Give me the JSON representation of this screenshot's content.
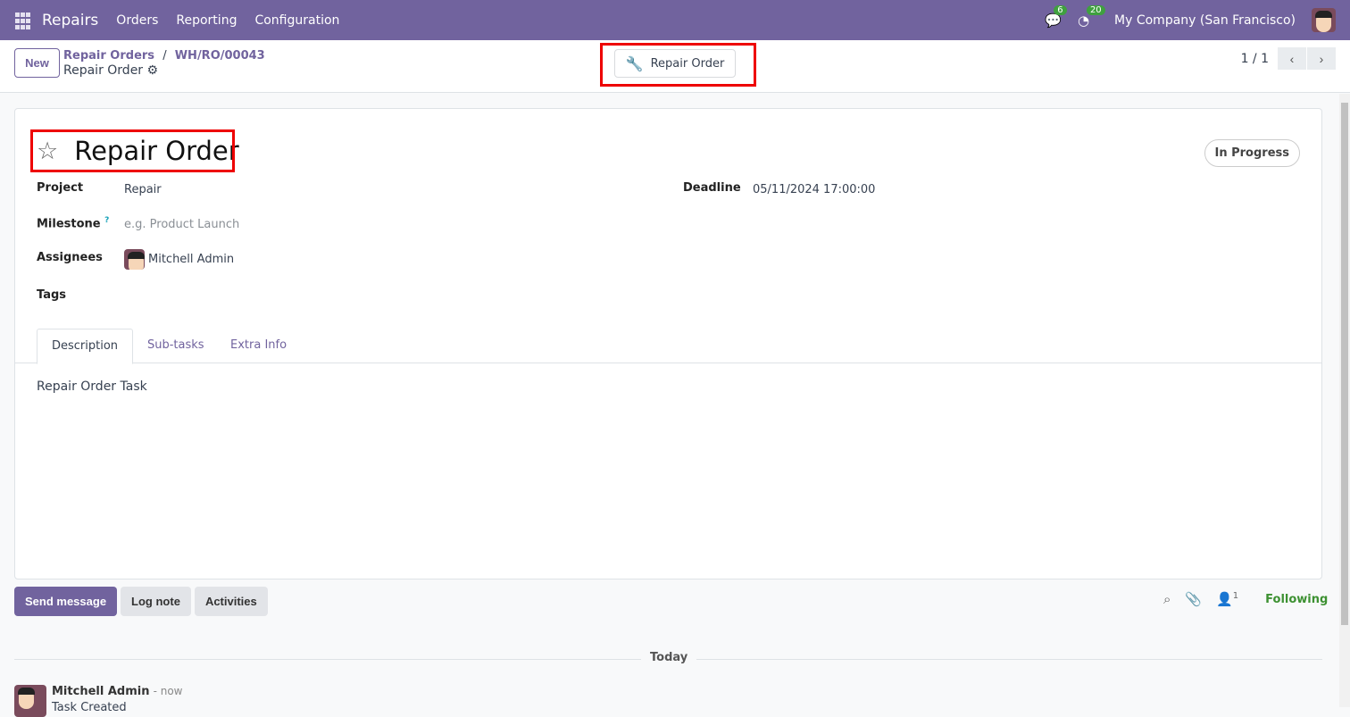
{
  "nav": {
    "app": "Repairs",
    "menu": [
      "Orders",
      "Reporting",
      "Configuration"
    ],
    "messages_count": "6",
    "activities_count": "20",
    "company": "My Company (San Francisco)"
  },
  "control": {
    "new_label": "New",
    "breadcrumb_parent": "Repair Orders",
    "breadcrumb_sep": "/",
    "breadcrumb_record": "WH/RO/00043",
    "current": "Repair Order",
    "smart_button": "Repair Order",
    "pager": "1 / 1"
  },
  "form": {
    "title": "Repair Order",
    "status": "In Progress",
    "project_label": "Project",
    "project": "Repair",
    "milestone_label": "Milestone",
    "milestone_help": "?",
    "milestone_placeholder": "e.g. Product Launch",
    "assignees_label": "Assignees",
    "assignee": "Mitchell Admin",
    "tags_label": "Tags",
    "deadline_label": "Deadline",
    "deadline": "05/11/2024 17:00:00",
    "tabs": [
      "Description",
      "Sub-tasks",
      "Extra Info"
    ],
    "description": "Repair Order Task"
  },
  "chatter": {
    "send": "Send message",
    "log": "Log note",
    "activities": "Activities",
    "followers_count": "1",
    "following": "Following",
    "today": "Today",
    "message": {
      "author": "Mitchell Admin",
      "time": "- now",
      "body": "Task Created"
    }
  }
}
